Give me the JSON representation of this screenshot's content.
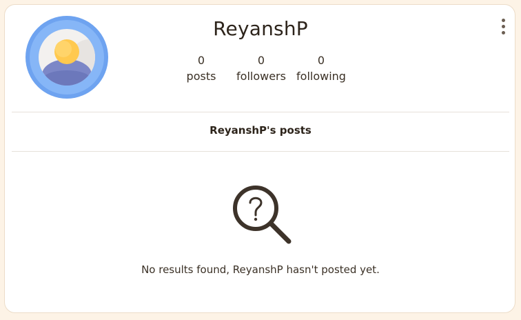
{
  "profile": {
    "username": "ReyanshP",
    "avatar_icon": "user-avatar-icon",
    "menu_icon": "more-vertical-icon"
  },
  "stats": [
    {
      "value": "0",
      "label": "posts"
    },
    {
      "value": "0",
      "label": "followers"
    },
    {
      "value": "0",
      "label": "following"
    }
  ],
  "posts_section": {
    "title": "ReyanshP's posts",
    "empty_icon": "search-question-icon",
    "empty_message": "No results found, ReyanshP hasn't posted yet."
  },
  "colors": {
    "page_background": "#fdf3e6",
    "card_background": "#ffffff",
    "avatar_ring": "#7fb0f5",
    "avatar_head": "#ffc64d",
    "avatar_body": "#7a86c9",
    "icon_dark": "#3d332a"
  }
}
